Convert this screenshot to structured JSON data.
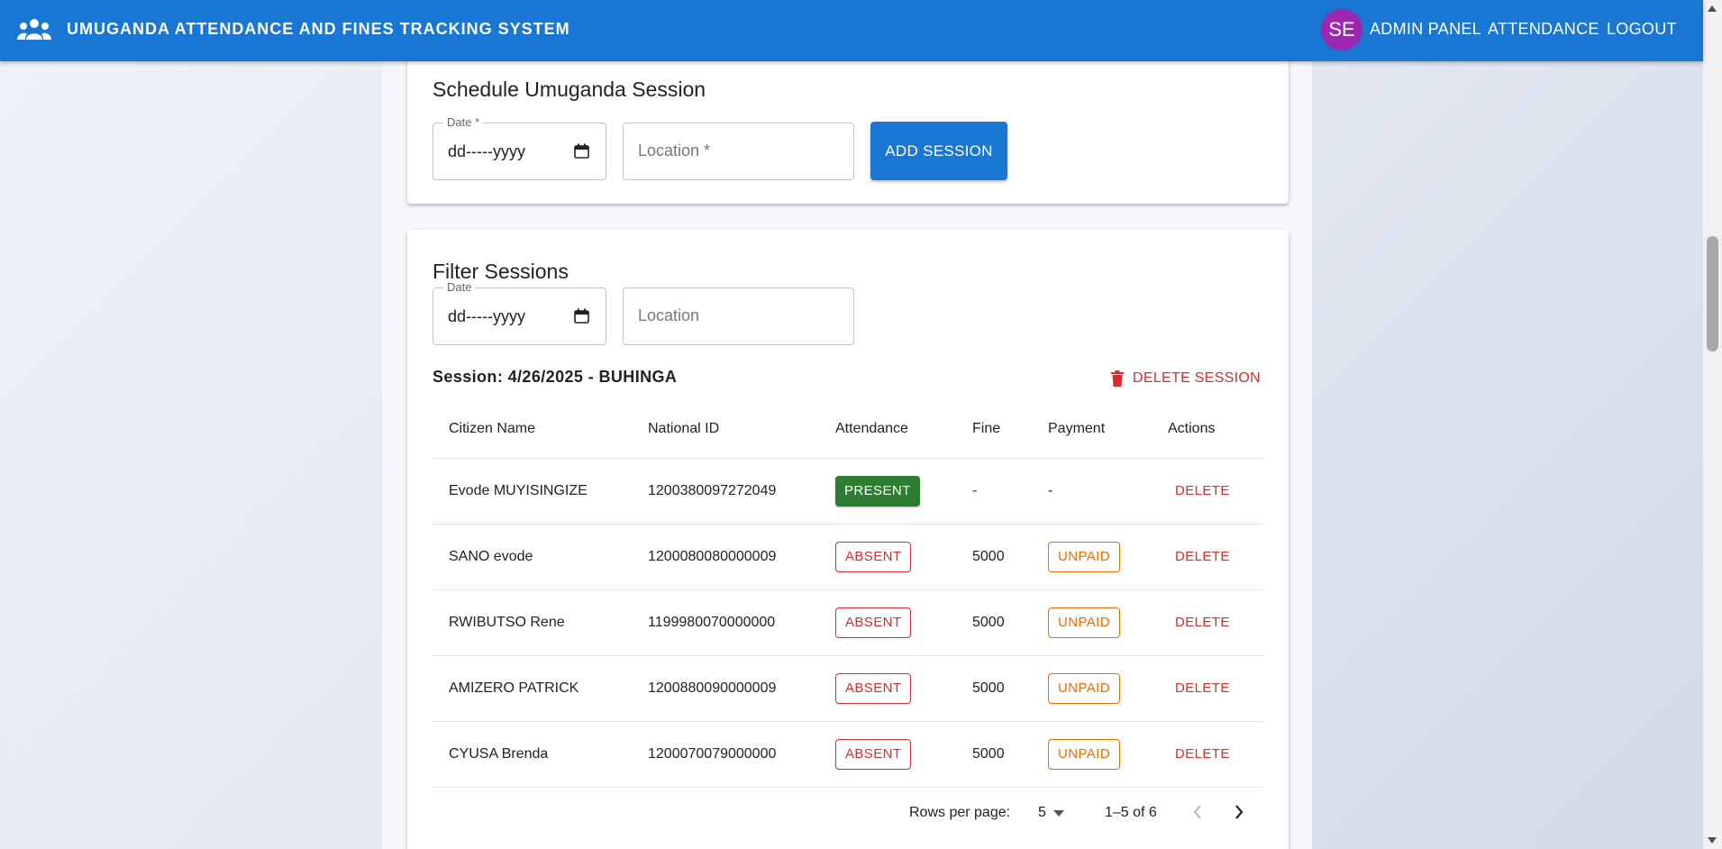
{
  "header": {
    "title": "UMUGANDA ATTENDANCE AND FINES TRACKING SYSTEM",
    "avatar_initials": "SE",
    "nav": [
      "ADMIN PANEL",
      "ATTENDANCE",
      "LOGOUT"
    ]
  },
  "schedule": {
    "title": "Schedule Umuganda Session",
    "date_label": "Date *",
    "date_value": "dd-----yyyy",
    "location_placeholder": "Location *",
    "add_button": "ADD SESSION"
  },
  "filter": {
    "title": "Filter Sessions",
    "date_label": "Date",
    "date_value": "dd-----yyyy",
    "location_placeholder": "Location"
  },
  "session": {
    "label": "Session: 4/26/2025 - BUHINGA",
    "delete_button": "DELETE SESSION"
  },
  "table": {
    "columns": [
      "Citizen Name",
      "National ID",
      "Attendance",
      "Fine",
      "Payment",
      "Actions"
    ],
    "rows": [
      {
        "name": "Evode MUYISINGIZE",
        "national_id": "1200380097272049",
        "attendance": "PRESENT",
        "fine": "-",
        "payment": "-",
        "action": "DELETE"
      },
      {
        "name": "SANO evode",
        "national_id": "1200080080000009",
        "attendance": "ABSENT",
        "fine": "5000",
        "payment": "UNPAID",
        "action": "DELETE"
      },
      {
        "name": "RWIBUTSO Rene",
        "national_id": "1199980070000000",
        "attendance": "ABSENT",
        "fine": "5000",
        "payment": "UNPAID",
        "action": "DELETE"
      },
      {
        "name": "AMIZERO PATRICK",
        "national_id": "1200880090000009",
        "attendance": "ABSENT",
        "fine": "5000",
        "payment": "UNPAID",
        "action": "DELETE"
      },
      {
        "name": "CYUSA Brenda",
        "national_id": "1200070079000000",
        "attendance": "ABSENT",
        "fine": "5000",
        "payment": "UNPAID",
        "action": "DELETE"
      }
    ]
  },
  "pagination": {
    "rows_per_page_label": "Rows per page:",
    "rows_per_page_value": "5",
    "range": "1–5 of 6"
  },
  "colors": {
    "primary": "#1976d2",
    "error": "#d32f2f",
    "warning": "#ed6c02",
    "success": "#2e7d32",
    "avatar": "#9c27b0"
  }
}
